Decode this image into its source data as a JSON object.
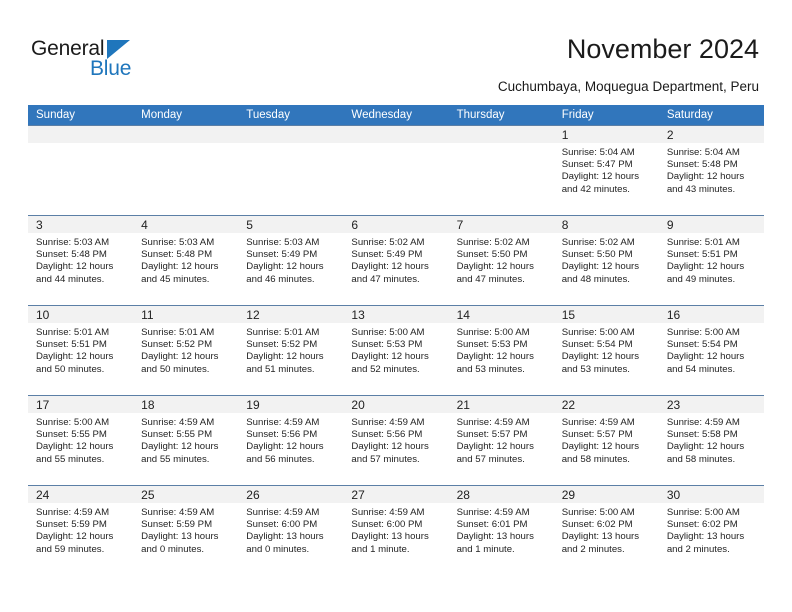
{
  "brand": {
    "name_top": "General",
    "name_bottom": "Blue",
    "triangle_color": "#1f76bc",
    "text_color": "#1b1b1b"
  },
  "header": {
    "title": "November 2024",
    "subtitle": "Cuchumbaya, Moquegua Department, Peru"
  },
  "colors": {
    "header_blue": "#3176bc",
    "date_band": "#f2f2f2",
    "cell_border": "#5b7fa6",
    "text": "#232323"
  },
  "calendar": {
    "day_headers": [
      "Sunday",
      "Monday",
      "Tuesday",
      "Wednesday",
      "Thursday",
      "Friday",
      "Saturday"
    ],
    "weeks": [
      [
        {
          "day": "",
          "empty": true
        },
        {
          "day": "",
          "empty": true
        },
        {
          "day": "",
          "empty": true
        },
        {
          "day": "",
          "empty": true
        },
        {
          "day": "",
          "empty": true
        },
        {
          "day": "1",
          "sunrise": "Sunrise: 5:04 AM",
          "sunset": "Sunset: 5:47 PM",
          "daylight_1": "Daylight: 12 hours",
          "daylight_2": "and 42 minutes."
        },
        {
          "day": "2",
          "sunrise": "Sunrise: 5:04 AM",
          "sunset": "Sunset: 5:48 PM",
          "daylight_1": "Daylight: 12 hours",
          "daylight_2": "and 43 minutes."
        }
      ],
      [
        {
          "day": "3",
          "sunrise": "Sunrise: 5:03 AM",
          "sunset": "Sunset: 5:48 PM",
          "daylight_1": "Daylight: 12 hours",
          "daylight_2": "and 44 minutes."
        },
        {
          "day": "4",
          "sunrise": "Sunrise: 5:03 AM",
          "sunset": "Sunset: 5:48 PM",
          "daylight_1": "Daylight: 12 hours",
          "daylight_2": "and 45 minutes."
        },
        {
          "day": "5",
          "sunrise": "Sunrise: 5:03 AM",
          "sunset": "Sunset: 5:49 PM",
          "daylight_1": "Daylight: 12 hours",
          "daylight_2": "and 46 minutes."
        },
        {
          "day": "6",
          "sunrise": "Sunrise: 5:02 AM",
          "sunset": "Sunset: 5:49 PM",
          "daylight_1": "Daylight: 12 hours",
          "daylight_2": "and 47 minutes."
        },
        {
          "day": "7",
          "sunrise": "Sunrise: 5:02 AM",
          "sunset": "Sunset: 5:50 PM",
          "daylight_1": "Daylight: 12 hours",
          "daylight_2": "and 47 minutes."
        },
        {
          "day": "8",
          "sunrise": "Sunrise: 5:02 AM",
          "sunset": "Sunset: 5:50 PM",
          "daylight_1": "Daylight: 12 hours",
          "daylight_2": "and 48 minutes."
        },
        {
          "day": "9",
          "sunrise": "Sunrise: 5:01 AM",
          "sunset": "Sunset: 5:51 PM",
          "daylight_1": "Daylight: 12 hours",
          "daylight_2": "and 49 minutes."
        }
      ],
      [
        {
          "day": "10",
          "sunrise": "Sunrise: 5:01 AM",
          "sunset": "Sunset: 5:51 PM",
          "daylight_1": "Daylight: 12 hours",
          "daylight_2": "and 50 minutes."
        },
        {
          "day": "11",
          "sunrise": "Sunrise: 5:01 AM",
          "sunset": "Sunset: 5:52 PM",
          "daylight_1": "Daylight: 12 hours",
          "daylight_2": "and 50 minutes."
        },
        {
          "day": "12",
          "sunrise": "Sunrise: 5:01 AM",
          "sunset": "Sunset: 5:52 PM",
          "daylight_1": "Daylight: 12 hours",
          "daylight_2": "and 51 minutes."
        },
        {
          "day": "13",
          "sunrise": "Sunrise: 5:00 AM",
          "sunset": "Sunset: 5:53 PM",
          "daylight_1": "Daylight: 12 hours",
          "daylight_2": "and 52 minutes."
        },
        {
          "day": "14",
          "sunrise": "Sunrise: 5:00 AM",
          "sunset": "Sunset: 5:53 PM",
          "daylight_1": "Daylight: 12 hours",
          "daylight_2": "and 53 minutes."
        },
        {
          "day": "15",
          "sunrise": "Sunrise: 5:00 AM",
          "sunset": "Sunset: 5:54 PM",
          "daylight_1": "Daylight: 12 hours",
          "daylight_2": "and 53 minutes."
        },
        {
          "day": "16",
          "sunrise": "Sunrise: 5:00 AM",
          "sunset": "Sunset: 5:54 PM",
          "daylight_1": "Daylight: 12 hours",
          "daylight_2": "and 54 minutes."
        }
      ],
      [
        {
          "day": "17",
          "sunrise": "Sunrise: 5:00 AM",
          "sunset": "Sunset: 5:55 PM",
          "daylight_1": "Daylight: 12 hours",
          "daylight_2": "and 55 minutes."
        },
        {
          "day": "18",
          "sunrise": "Sunrise: 4:59 AM",
          "sunset": "Sunset: 5:55 PM",
          "daylight_1": "Daylight: 12 hours",
          "daylight_2": "and 55 minutes."
        },
        {
          "day": "19",
          "sunrise": "Sunrise: 4:59 AM",
          "sunset": "Sunset: 5:56 PM",
          "daylight_1": "Daylight: 12 hours",
          "daylight_2": "and 56 minutes."
        },
        {
          "day": "20",
          "sunrise": "Sunrise: 4:59 AM",
          "sunset": "Sunset: 5:56 PM",
          "daylight_1": "Daylight: 12 hours",
          "daylight_2": "and 57 minutes."
        },
        {
          "day": "21",
          "sunrise": "Sunrise: 4:59 AM",
          "sunset": "Sunset: 5:57 PM",
          "daylight_1": "Daylight: 12 hours",
          "daylight_2": "and 57 minutes."
        },
        {
          "day": "22",
          "sunrise": "Sunrise: 4:59 AM",
          "sunset": "Sunset: 5:57 PM",
          "daylight_1": "Daylight: 12 hours",
          "daylight_2": "and 58 minutes."
        },
        {
          "day": "23",
          "sunrise": "Sunrise: 4:59 AM",
          "sunset": "Sunset: 5:58 PM",
          "daylight_1": "Daylight: 12 hours",
          "daylight_2": "and 58 minutes."
        }
      ],
      [
        {
          "day": "24",
          "sunrise": "Sunrise: 4:59 AM",
          "sunset": "Sunset: 5:59 PM",
          "daylight_1": "Daylight: 12 hours",
          "daylight_2": "and 59 minutes."
        },
        {
          "day": "25",
          "sunrise": "Sunrise: 4:59 AM",
          "sunset": "Sunset: 5:59 PM",
          "daylight_1": "Daylight: 13 hours",
          "daylight_2": "and 0 minutes."
        },
        {
          "day": "26",
          "sunrise": "Sunrise: 4:59 AM",
          "sunset": "Sunset: 6:00 PM",
          "daylight_1": "Daylight: 13 hours",
          "daylight_2": "and 0 minutes."
        },
        {
          "day": "27",
          "sunrise": "Sunrise: 4:59 AM",
          "sunset": "Sunset: 6:00 PM",
          "daylight_1": "Daylight: 13 hours",
          "daylight_2": "and 1 minute."
        },
        {
          "day": "28",
          "sunrise": "Sunrise: 4:59 AM",
          "sunset": "Sunset: 6:01 PM",
          "daylight_1": "Daylight: 13 hours",
          "daylight_2": "and 1 minute."
        },
        {
          "day": "29",
          "sunrise": "Sunrise: 5:00 AM",
          "sunset": "Sunset: 6:02 PM",
          "daylight_1": "Daylight: 13 hours",
          "daylight_2": "and 2 minutes."
        },
        {
          "day": "30",
          "sunrise": "Sunrise: 5:00 AM",
          "sunset": "Sunset: 6:02 PM",
          "daylight_1": "Daylight: 13 hours",
          "daylight_2": "and 2 minutes."
        }
      ]
    ]
  }
}
